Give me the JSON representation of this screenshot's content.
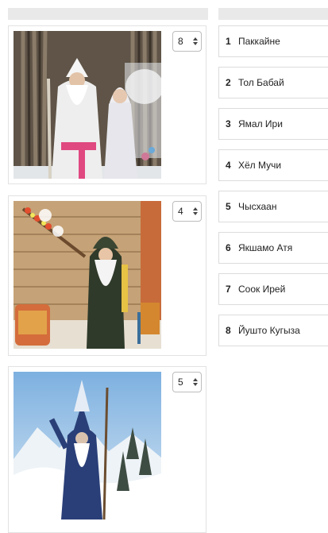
{
  "header": {
    "left": "",
    "right": ""
  },
  "cards": [
    {
      "selected": "8",
      "photo": "Ded Moroz and Snegurochka in winter forest"
    },
    {
      "selected": "4",
      "photo": "Winter spirit with staff in wooden hut"
    },
    {
      "selected": "5",
      "photo": "Winter spirit on snowy mountain"
    }
  ],
  "list": [
    {
      "num": "1",
      "name": "Паккайне"
    },
    {
      "num": "2",
      "name": "Тол Бабай"
    },
    {
      "num": "3",
      "name": "Ямал Ири"
    },
    {
      "num": "4",
      "name": "Хёл Мучи"
    },
    {
      "num": "5",
      "name": "Чысхаан"
    },
    {
      "num": "6",
      "name": "Якшамо Атя"
    },
    {
      "num": "7",
      "name": "Соок Ирей"
    },
    {
      "num": "8",
      "name": "Йушто Кугыза"
    }
  ]
}
